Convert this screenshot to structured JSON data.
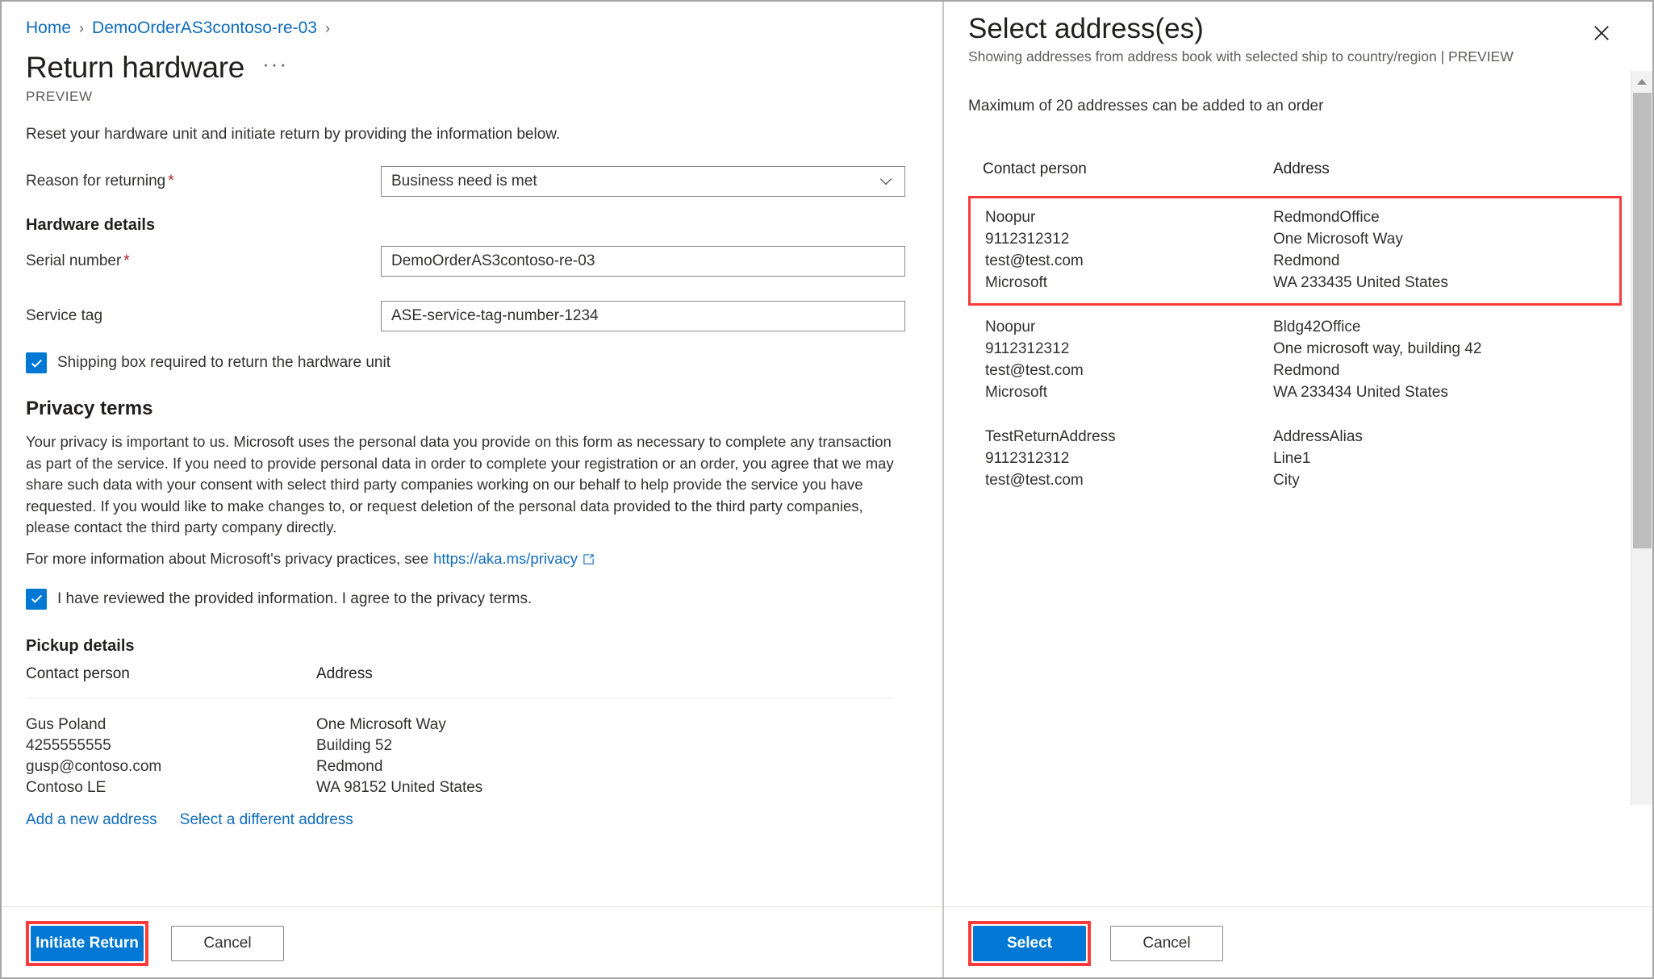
{
  "breadcrumb": {
    "items": [
      "Home",
      "DemoOrderAS3contoso-re-03"
    ],
    "separator": "›"
  },
  "left": {
    "title": "Return hardware",
    "ellipsis": "···",
    "preview_tag": "PREVIEW",
    "intro": "Reset your hardware unit and initiate return by providing the information below.",
    "reason": {
      "label": "Reason for returning",
      "required_mark": "*",
      "value": "Business need is met"
    },
    "hardware_details": {
      "heading": "Hardware details",
      "serial": {
        "label": "Serial number",
        "required_mark": "*",
        "value": "DemoOrderAS3contoso-re-03"
      },
      "service_tag": {
        "label": "Service tag",
        "value": "ASE-service-tag-number-1234"
      }
    },
    "shipping_box_checkbox": {
      "label": "Shipping box required to return the hardware unit",
      "checked": true
    },
    "privacy": {
      "heading": "Privacy terms",
      "body": "Your privacy is important to us. Microsoft uses the personal data you provide on this form as necessary to complete any transaction as part of the service. If you need to provide personal data in order to complete your registration or an order, you agree that we may share such data with your consent with select third party companies working on our behalf to help provide the service you have requested. If you would like to make changes to, or request deletion of the personal data provided to the third party companies, please contact the third party company directly.",
      "link_prefix": "For more information about Microsoft's privacy practices, see",
      "link_text": "https://aka.ms/privacy",
      "consent_checkbox": {
        "label": "I have reviewed the provided information. I agree to the privacy terms.",
        "checked": true
      }
    },
    "pickup": {
      "heading": "Pickup details",
      "columns": [
        "Contact person",
        "Address"
      ],
      "contact": [
        "Gus Poland",
        "4255555555",
        "gusp@contoso.com",
        "Contoso LE"
      ],
      "address": [
        "One Microsoft Way",
        "Building 52",
        "Redmond",
        "WA 98152 United States"
      ],
      "links": [
        "Add a new address",
        "Select a different address"
      ]
    },
    "footer": {
      "primary": "Initiate Return",
      "secondary": "Cancel"
    }
  },
  "right": {
    "title": "Select address(es)",
    "subtitle": "Showing addresses from address book with selected ship to country/region | PREVIEW",
    "note": "Maximum of 20 addresses can be added to an order",
    "columns": [
      "Contact person",
      "Address"
    ],
    "rows": [
      {
        "selected": true,
        "contact": [
          "Noopur",
          "9112312312",
          "test@test.com",
          "Microsoft"
        ],
        "address": [
          "RedmondOffice",
          "One Microsoft Way",
          "Redmond",
          "WA 233435 United States"
        ]
      },
      {
        "selected": false,
        "contact": [
          "Noopur",
          "9112312312",
          "test@test.com",
          "Microsoft"
        ],
        "address": [
          "Bldg42Office",
          "One microsoft way, building 42",
          "Redmond",
          "WA 233434 United States"
        ]
      },
      {
        "selected": false,
        "contact": [
          "TestReturnAddress",
          "9112312312",
          "test@test.com"
        ],
        "address": [
          "AddressAlias",
          "Line1",
          "City"
        ]
      }
    ],
    "footer": {
      "primary": "Select",
      "secondary": "Cancel"
    },
    "close_label": "Close"
  },
  "colors": {
    "accent": "#0078d4",
    "link": "#0f6cbd",
    "highlight": "#fb3b3b",
    "required": "#a4262c"
  }
}
